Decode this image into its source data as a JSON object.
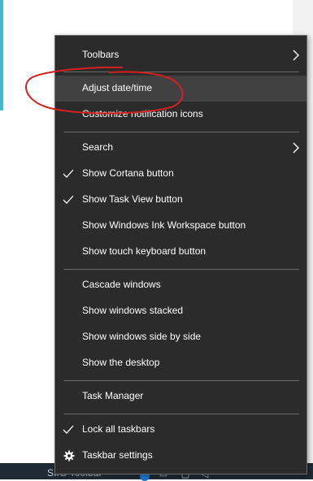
{
  "menu": {
    "items": [
      {
        "label": "Toolbars"
      },
      {
        "label": "Adjust date/time"
      },
      {
        "label": "Customize notification icons"
      },
      {
        "label": "Search"
      },
      {
        "label": "Show Cortana button"
      },
      {
        "label": "Show Task View button"
      },
      {
        "label": "Show Windows Ink Workspace button"
      },
      {
        "label": "Show touch keyboard button"
      },
      {
        "label": "Cascade windows"
      },
      {
        "label": "Show windows stacked"
      },
      {
        "label": "Show windows side by side"
      },
      {
        "label": "Show the desktop"
      },
      {
        "label": "Task Manager"
      },
      {
        "label": "Lock all taskbars"
      },
      {
        "label": "Taskbar settings"
      }
    ]
  },
  "taskbar": {
    "label": "SIIG Toolbar"
  },
  "colors": {
    "menu_bg": "#2b2b2b",
    "menu_hover": "#414141",
    "annotation": "#d42020",
    "taskbar_bg": "#1f2a33",
    "accent": "#3fb7cf"
  }
}
